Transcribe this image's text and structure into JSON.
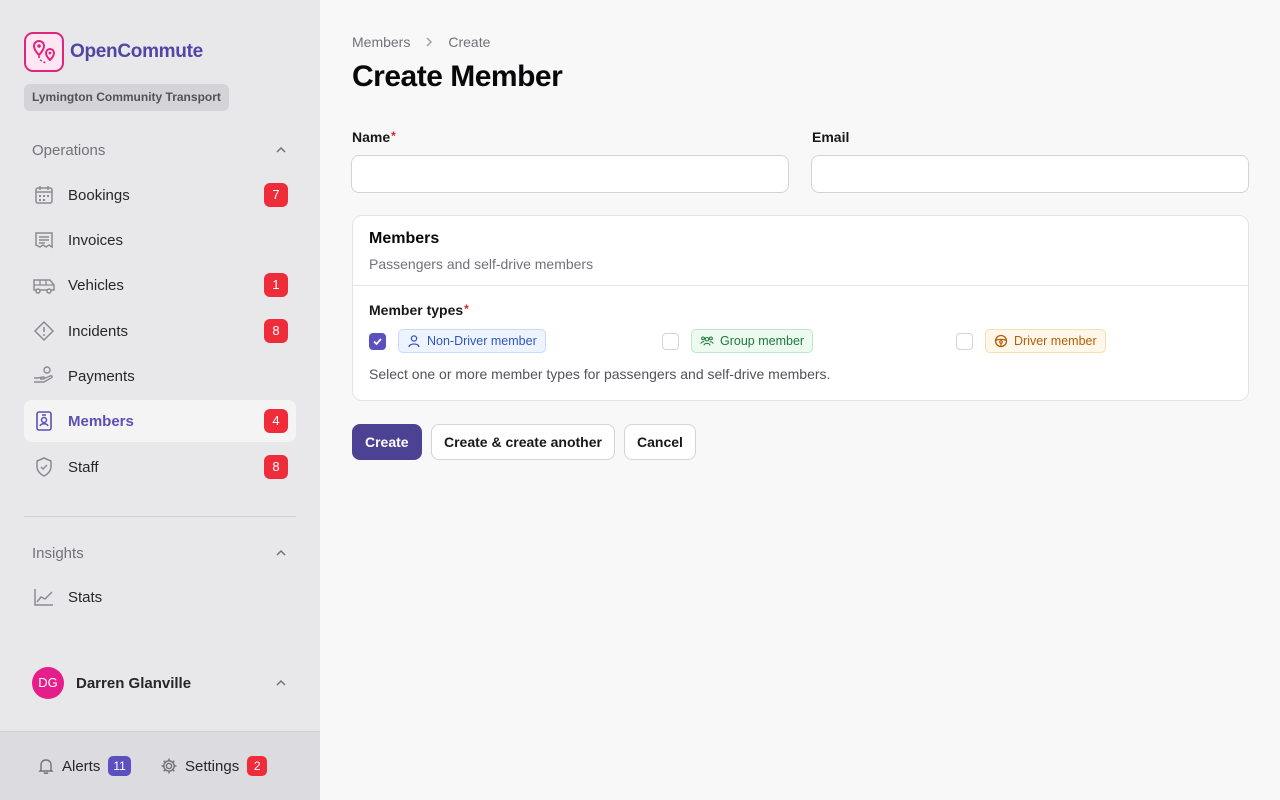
{
  "app": {
    "name": "OpenCommute",
    "organization": "Lymington Community Transport"
  },
  "sidebar": {
    "groups": [
      {
        "label": "Operations",
        "items": [
          {
            "label": "Bookings",
            "icon": "calendar-icon",
            "badge": "7"
          },
          {
            "label": "Invoices",
            "icon": "receipt-icon",
            "badge": ""
          },
          {
            "label": "Vehicles",
            "icon": "bus-icon",
            "badge": "1"
          },
          {
            "label": "Incidents",
            "icon": "warning-icon",
            "badge": "8"
          },
          {
            "label": "Payments",
            "icon": "hand-coins-icon",
            "badge": ""
          },
          {
            "label": "Members",
            "icon": "id-badge-icon",
            "badge": "4",
            "active": true
          },
          {
            "label": "Staff",
            "icon": "shield-check-icon",
            "badge": "8"
          }
        ]
      },
      {
        "label": "Insights",
        "items": [
          {
            "label": "Stats",
            "icon": "chart-line-icon",
            "badge": ""
          }
        ]
      }
    ],
    "user": {
      "initials": "DG",
      "name": "Darren Glanville"
    },
    "footer": {
      "alerts": {
        "label": "Alerts",
        "count": "11"
      },
      "settings": {
        "label": "Settings",
        "count": "2"
      }
    }
  },
  "breadcrumb": [
    "Members",
    "Create"
  ],
  "page_title": "Create Member",
  "form": {
    "name": {
      "label": "Name",
      "required_mark": "*",
      "value": ""
    },
    "email": {
      "label": "Email",
      "value": ""
    },
    "section": {
      "title": "Members",
      "description": "Passengers and self-drive members",
      "member_types_label": "Member types",
      "required_mark": "*",
      "options": [
        {
          "label": "Non-Driver member",
          "checked": true
        },
        {
          "label": "Group member",
          "checked": false
        },
        {
          "label": "Driver member",
          "checked": false
        }
      ],
      "help": "Select one or more member types for passengers and self-drive members."
    },
    "buttons": {
      "create": "Create",
      "create_another": "Create & create another",
      "cancel": "Cancel"
    }
  },
  "colors": {
    "brand": "#4f46a5",
    "logo_accent": "#e0267c",
    "badge_red": "#ef2d3a",
    "alerts_badge": "#5b50c0",
    "primary_button": "#4b4293"
  }
}
